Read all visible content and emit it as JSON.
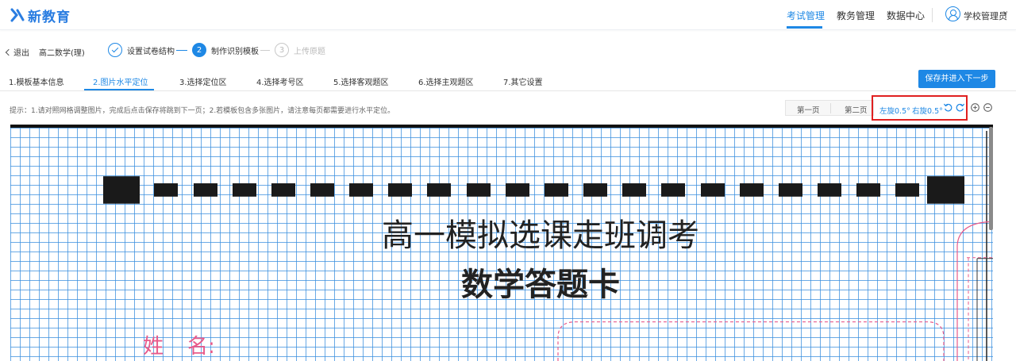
{
  "app": {
    "logo_text": "新教育",
    "brand_color": "#1e88e5"
  },
  "topnav": {
    "items": [
      "考试管理",
      "教务管理",
      "数据中心"
    ],
    "active_index": 0,
    "user": "学校管理员"
  },
  "stepbar": {
    "back_label": "退出",
    "subject": "高二数学(理)",
    "steps": [
      {
        "index": "",
        "label": "设置试卷结构",
        "state": "done"
      },
      {
        "index": "2",
        "label": "制作识别模板",
        "state": "current"
      },
      {
        "index": "3",
        "label": "上传原题",
        "state": "todo"
      }
    ]
  },
  "tabs": {
    "items": [
      "1.模板基本信息",
      "2.图片水平定位",
      "3.选择定位区",
      "4.选择考号区",
      "5.选择客观题区",
      "6.选择主观题区",
      "7.其它设置"
    ],
    "active_index": 1,
    "primary_button": "保存并进入下一步"
  },
  "hint": "提示：1.请对照网格调整图片，完成后点击保存将跳到下一页；2.若模板包含多张图片，请注意每页都需要进行水平定位。",
  "pages": {
    "first": "第一页",
    "second": "第二页"
  },
  "rotate": {
    "left": "左旋0.5°",
    "right": "右旋0.5°"
  },
  "sheet": {
    "title_line1": "高一模拟选课走班调考",
    "title_line2": "数学答题卡",
    "name_label_1": "姓",
    "name_label_2": "名:"
  }
}
